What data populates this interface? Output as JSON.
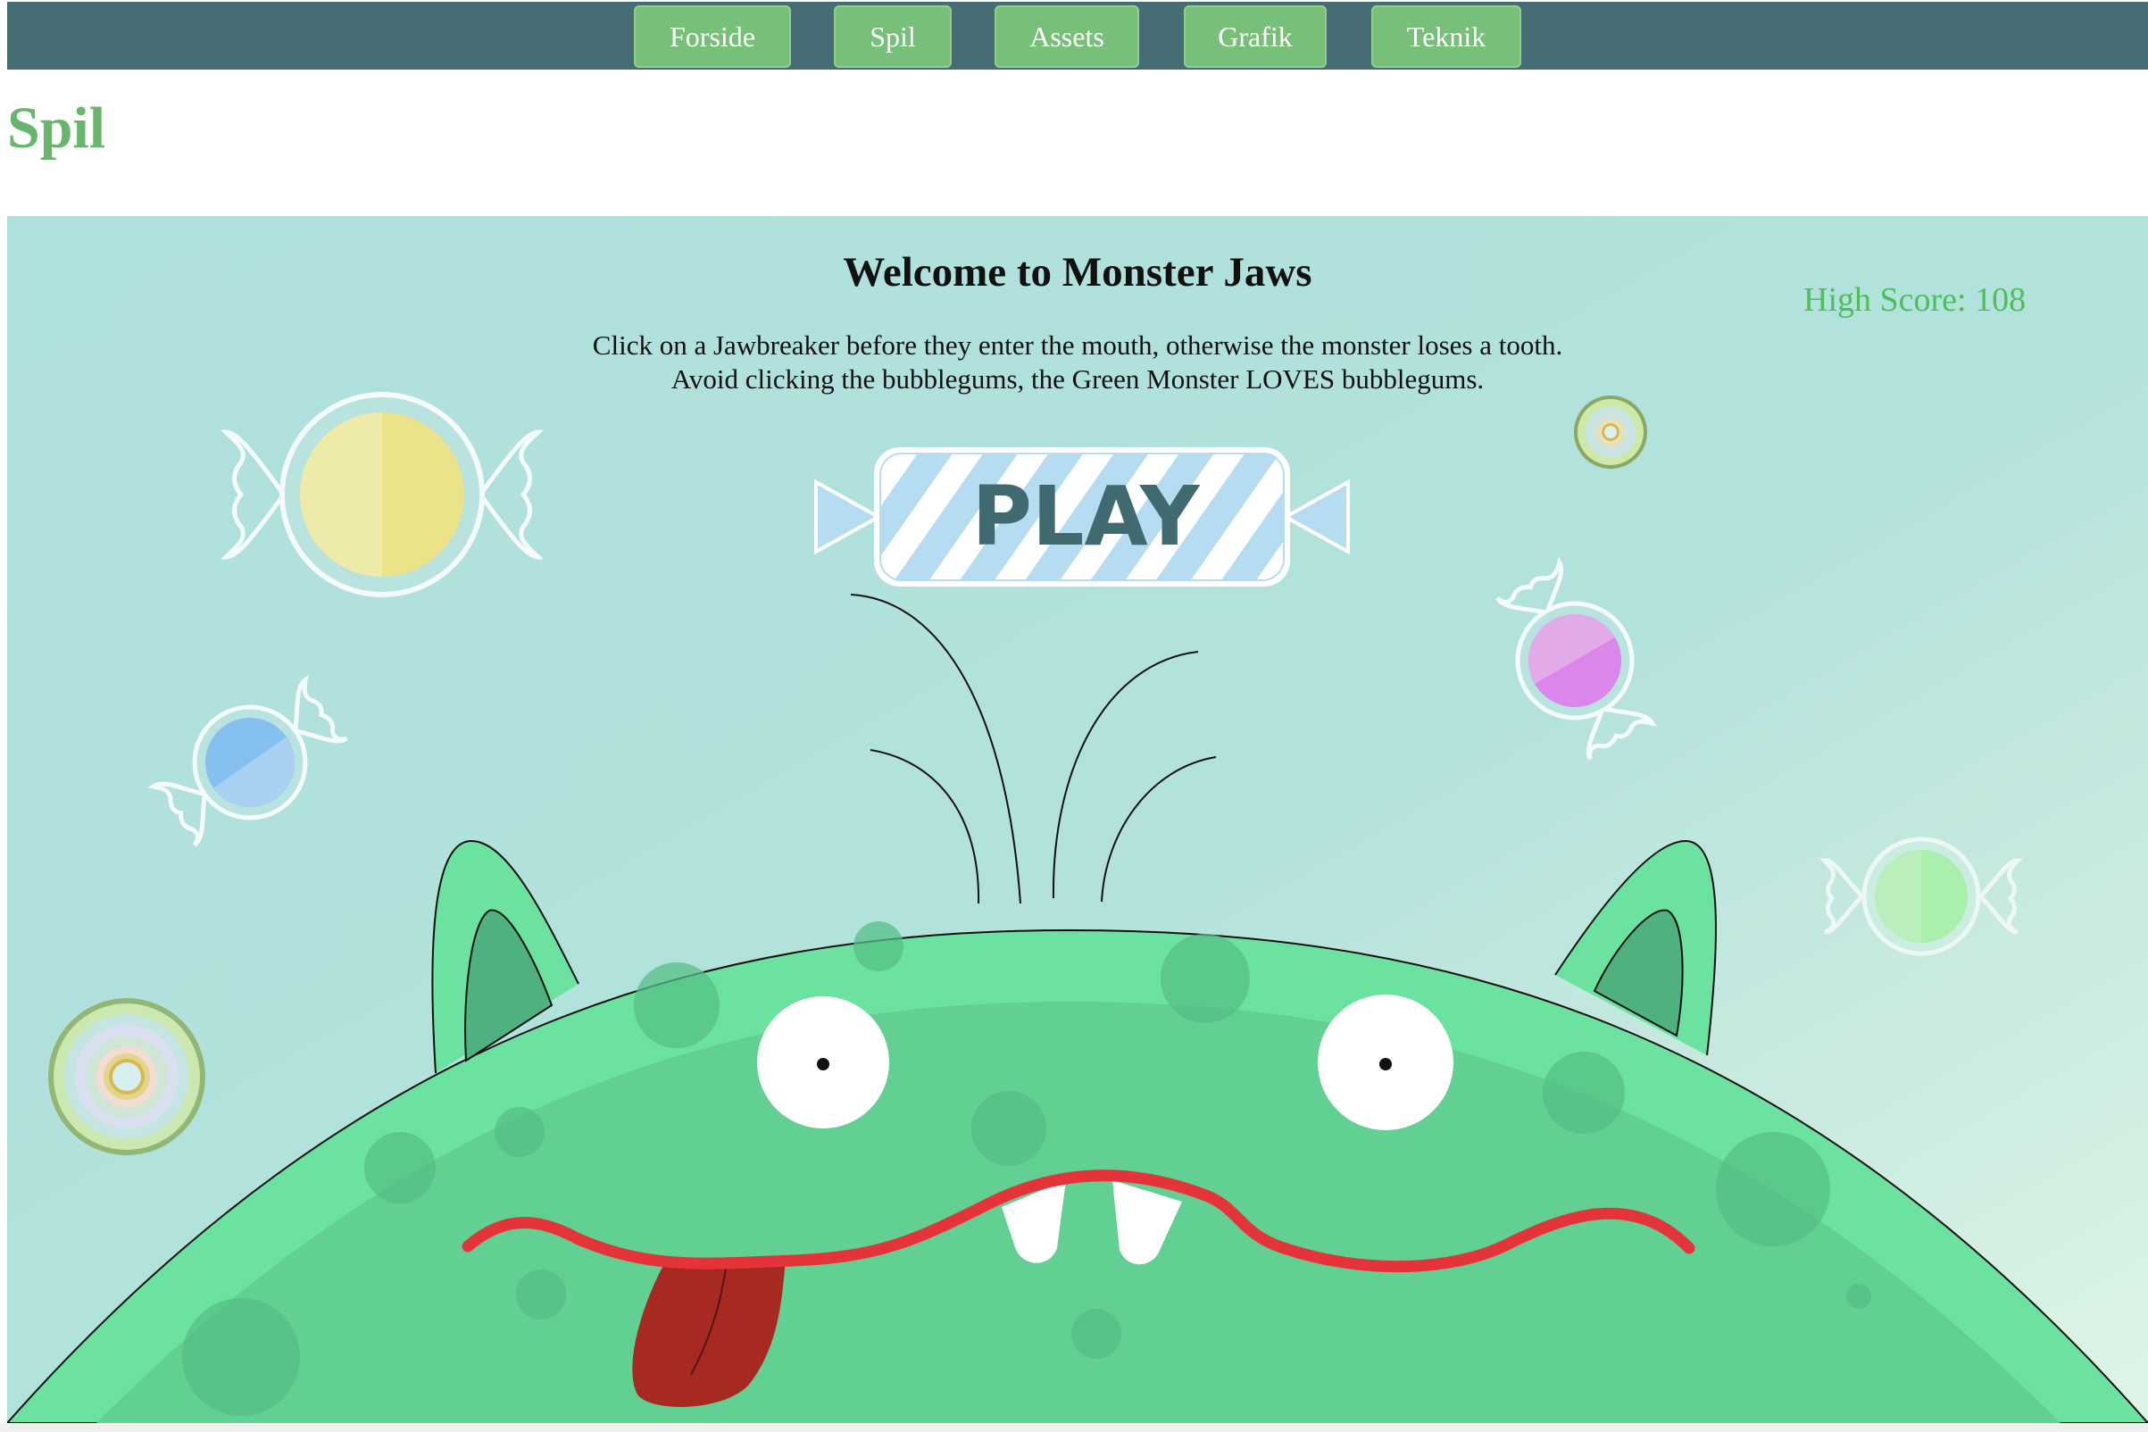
{
  "nav": {
    "items": [
      {
        "label": "Forside"
      },
      {
        "label": "Spil"
      },
      {
        "label": "Assets"
      },
      {
        "label": "Grafik"
      },
      {
        "label": "Teknik"
      }
    ]
  },
  "page": {
    "heading": "Spil"
  },
  "game": {
    "title": "Welcome to Monster Jaws",
    "instructions_line1": "Click on a Jawbreaker before they enter the mouth, otherwise the monster loses a tooth.",
    "instructions_line2": "Avoid clicking the bubblegums, the Green Monster LOVES bubblegums.",
    "high_score_label": "High Score:",
    "high_score_value": "108",
    "play_label": "PLAY",
    "candies": [
      {
        "kind": "bubblegum",
        "color": "#ebe38a",
        "icon": "yellow-bubblegum"
      },
      {
        "kind": "bubblegum",
        "color": "#86c0ef",
        "icon": "blue-bubblegum"
      },
      {
        "kind": "bubblegum",
        "color": "#dc85ea",
        "icon": "purple-bubblegum"
      },
      {
        "kind": "bubblegum",
        "color": "#a6f2a4",
        "icon": "green-bubblegum"
      },
      {
        "kind": "jawbreaker",
        "icon": "small-jawbreaker"
      },
      {
        "kind": "jawbreaker",
        "icon": "large-jawbreaker"
      }
    ],
    "colors": {
      "nav_bar": "#456d73",
      "nav_button": "#78bf7a",
      "heading": "#6ab56e",
      "monster": "#6be2a0",
      "monster_face": "#62cf93",
      "mouth": "#e5333a",
      "tongue": "#a72a22",
      "high_score": "#4dbf5a"
    }
  }
}
